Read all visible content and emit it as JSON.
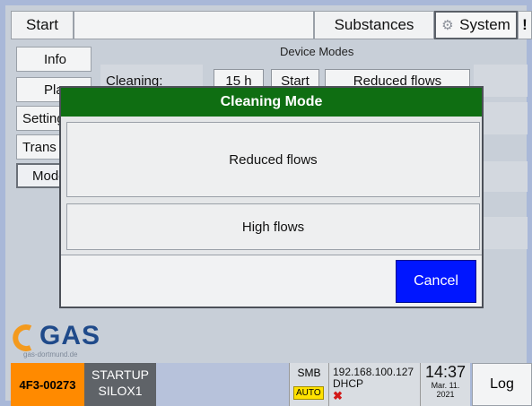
{
  "top": {
    "start": "Start",
    "substances": "Substances",
    "system": "System",
    "excl": "!"
  },
  "side_nav": [
    {
      "label": "Info"
    },
    {
      "label": "Plan"
    },
    {
      "label": "Settings"
    },
    {
      "label": "Trans"
    },
    {
      "label": "Modes"
    }
  ],
  "device_modes": {
    "title": "Device Modes",
    "cleaning_label": "Cleaning:",
    "hours": "15 h",
    "start": "Start",
    "mode": "Reduced flows"
  },
  "modal": {
    "title": "Cleaning Mode",
    "option1": "Reduced flows",
    "option2": "High flows",
    "cancel": "Cancel"
  },
  "logo": {
    "text": "GAS",
    "sub": "gas-dortmund.de"
  },
  "status": {
    "code": "4F3-00273",
    "state1": "STARTUP",
    "state2": "SILOX1",
    "smb": "SMB",
    "auto": "AUTO",
    "ip": "192.168.100.127",
    "dhcp": "DHCP",
    "time": "14:37",
    "date": "Mar. 11.",
    "year": "2021",
    "log": "Log"
  },
  "colors": {
    "header_green": "#0f6e12",
    "cancel_blue": "#0016ff",
    "status_orange": "#ff8a00"
  }
}
